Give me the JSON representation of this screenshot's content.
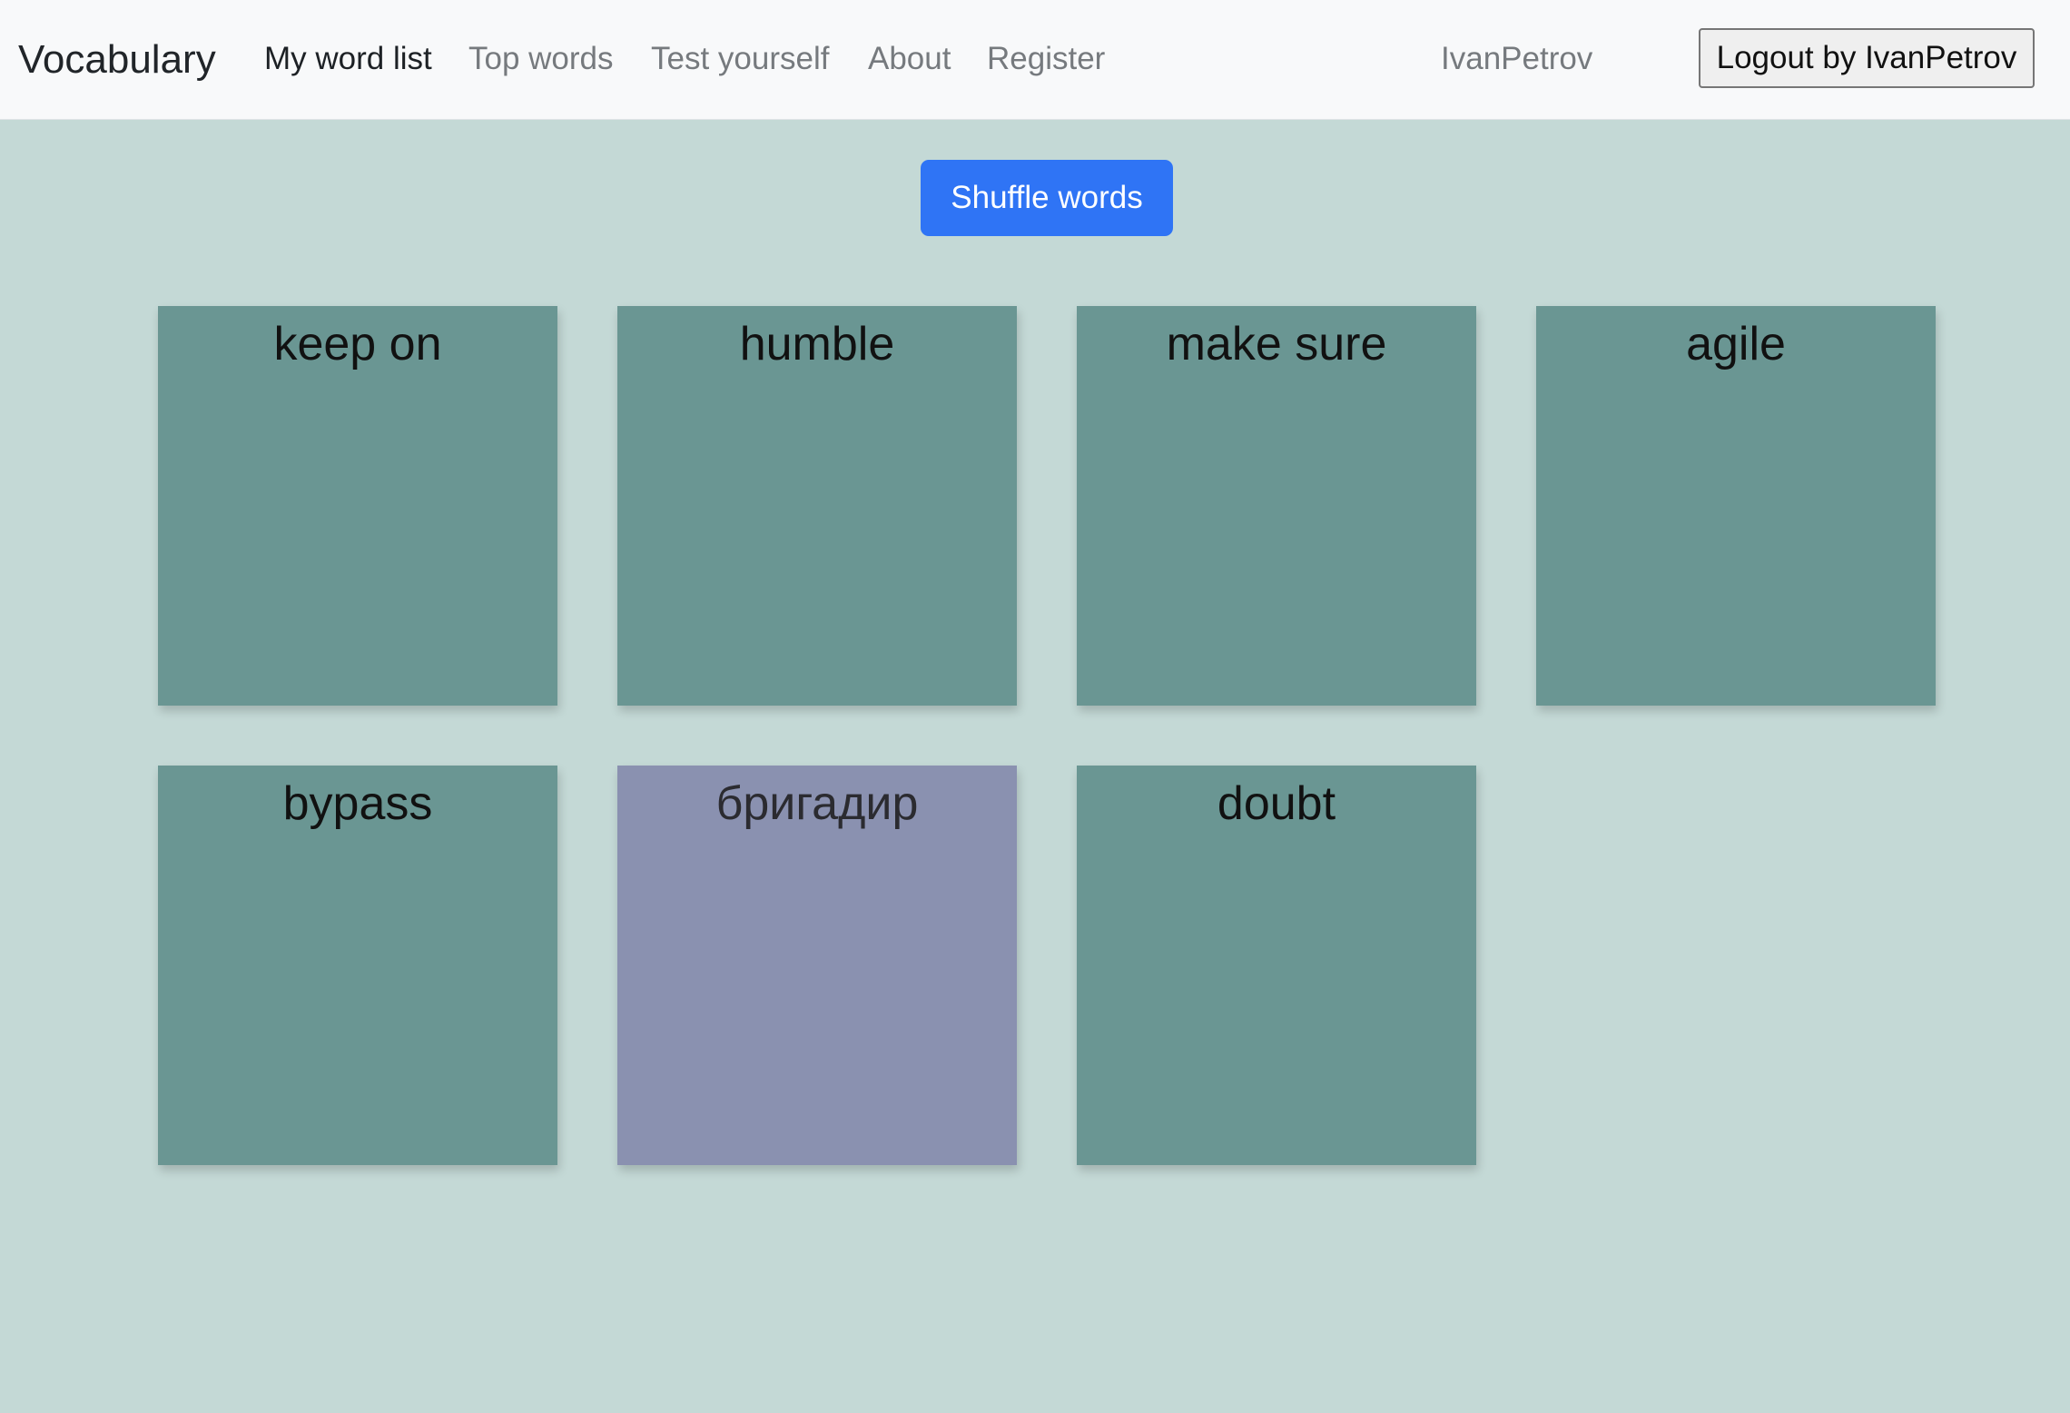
{
  "navbar": {
    "brand": "Vocabulary",
    "links": [
      {
        "label": "My word list",
        "active": true
      },
      {
        "label": "Top words",
        "active": false
      },
      {
        "label": "Test yourself",
        "active": false
      },
      {
        "label": "About",
        "active": false
      },
      {
        "label": "Register",
        "active": false
      }
    ],
    "username": "IvanPetrov",
    "logout_label": "Logout by IvanPetrov"
  },
  "actions": {
    "shuffle_label": "Shuffle words"
  },
  "cards": [
    {
      "word": "keep on",
      "color": "#6a9693"
    },
    {
      "word": "humble",
      "color": "#6a9693"
    },
    {
      "word": "make sure",
      "color": "#6a9693"
    },
    {
      "word": "agile",
      "color": "#6a9693"
    },
    {
      "word": "bypass",
      "color": "#6a9693"
    },
    {
      "word": "бригадир",
      "color": "#8a91b0"
    },
    {
      "word": "doubt",
      "color": "#6a9693"
    }
  ],
  "colors": {
    "page_background": "#c4d9d6",
    "navbar_background": "#f8f9fa",
    "primary_button": "#2f74f5",
    "card_default": "#6a9693",
    "card_highlight": "#8a91b0"
  }
}
